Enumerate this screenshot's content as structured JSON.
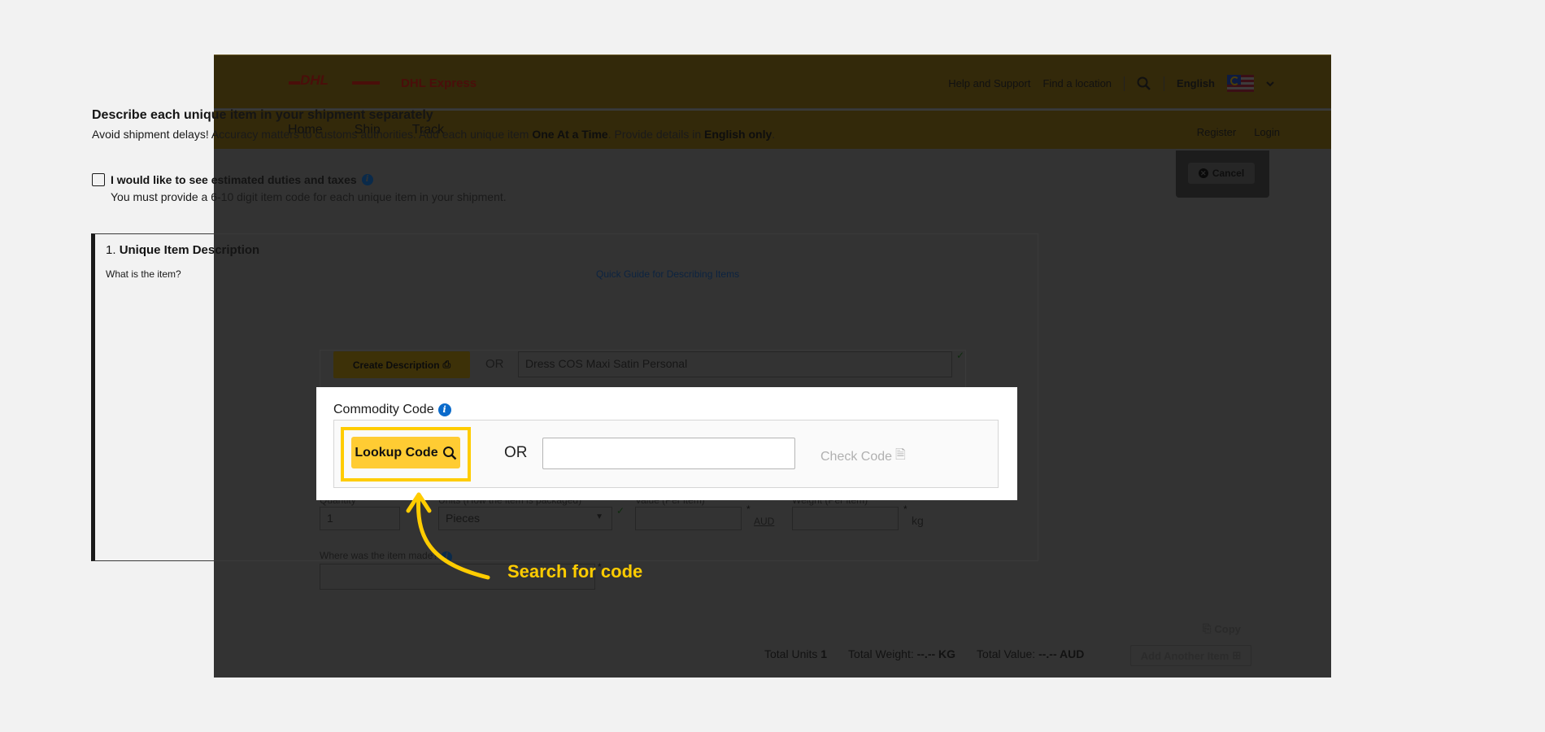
{
  "header": {
    "logo": "DHL",
    "brand": "DHL Express",
    "top_links": [
      "Help and Support",
      "Find a location"
    ],
    "search_icon": "search-icon",
    "language": "English",
    "flag_icon": "malaysia-flag-icon",
    "nav": [
      "Home",
      "Ship",
      "Track"
    ],
    "nav_right": [
      "Register",
      "Login"
    ]
  },
  "page": {
    "heading": "Describe each unique item in your shipment separately",
    "subtext_pre": "Avoid shipment delays! Accuracy matters to customs authorities.  Add each unique item ",
    "subtext_bold1": "One At a Time",
    "subtext_mid": ".  Provide details in ",
    "subtext_bold2": "English only",
    "subtext_post": ".",
    "cancel_label": "Cancel",
    "duties_checkbox_label": "I would like to see estimated duties and taxes",
    "duties_note": "You must provide a 6-10 digit item code for each unique item in your shipment."
  },
  "item": {
    "number": "1.",
    "title": "Unique Item Description",
    "what_label": "What is the item?",
    "guide_link": "Quick Guide for Describing Items",
    "create_description_label": "Create Description",
    "or": "OR",
    "description_value": "Dress COS Maxi Satin Personal",
    "quantity_label": "Quantity",
    "quantity_value": "1",
    "units_label": "Units (How the item is packaged)",
    "units_value": "Pieces",
    "value_label": "Value (Per item)",
    "value_currency": "AUD",
    "weight_label": "Weight (Per item)",
    "weight_unit": "kg",
    "origin_label": "Where was the item made?",
    "copy_label": "Copy"
  },
  "commodity": {
    "label": "Commodity Code",
    "lookup_label": "Lookup Code",
    "or": "OR",
    "code_value": "",
    "check_label": "Check Code"
  },
  "totals": {
    "units_label": "Total Units",
    "units_value": "1",
    "weight_label": "Total Weight:",
    "weight_value": "--.-- KG",
    "value_label": "Total Value:",
    "value_value": "--.-- AUD",
    "add_label": "Add Another Item"
  },
  "annotation": {
    "text": "Search for code",
    "color": "#ffcc00"
  }
}
